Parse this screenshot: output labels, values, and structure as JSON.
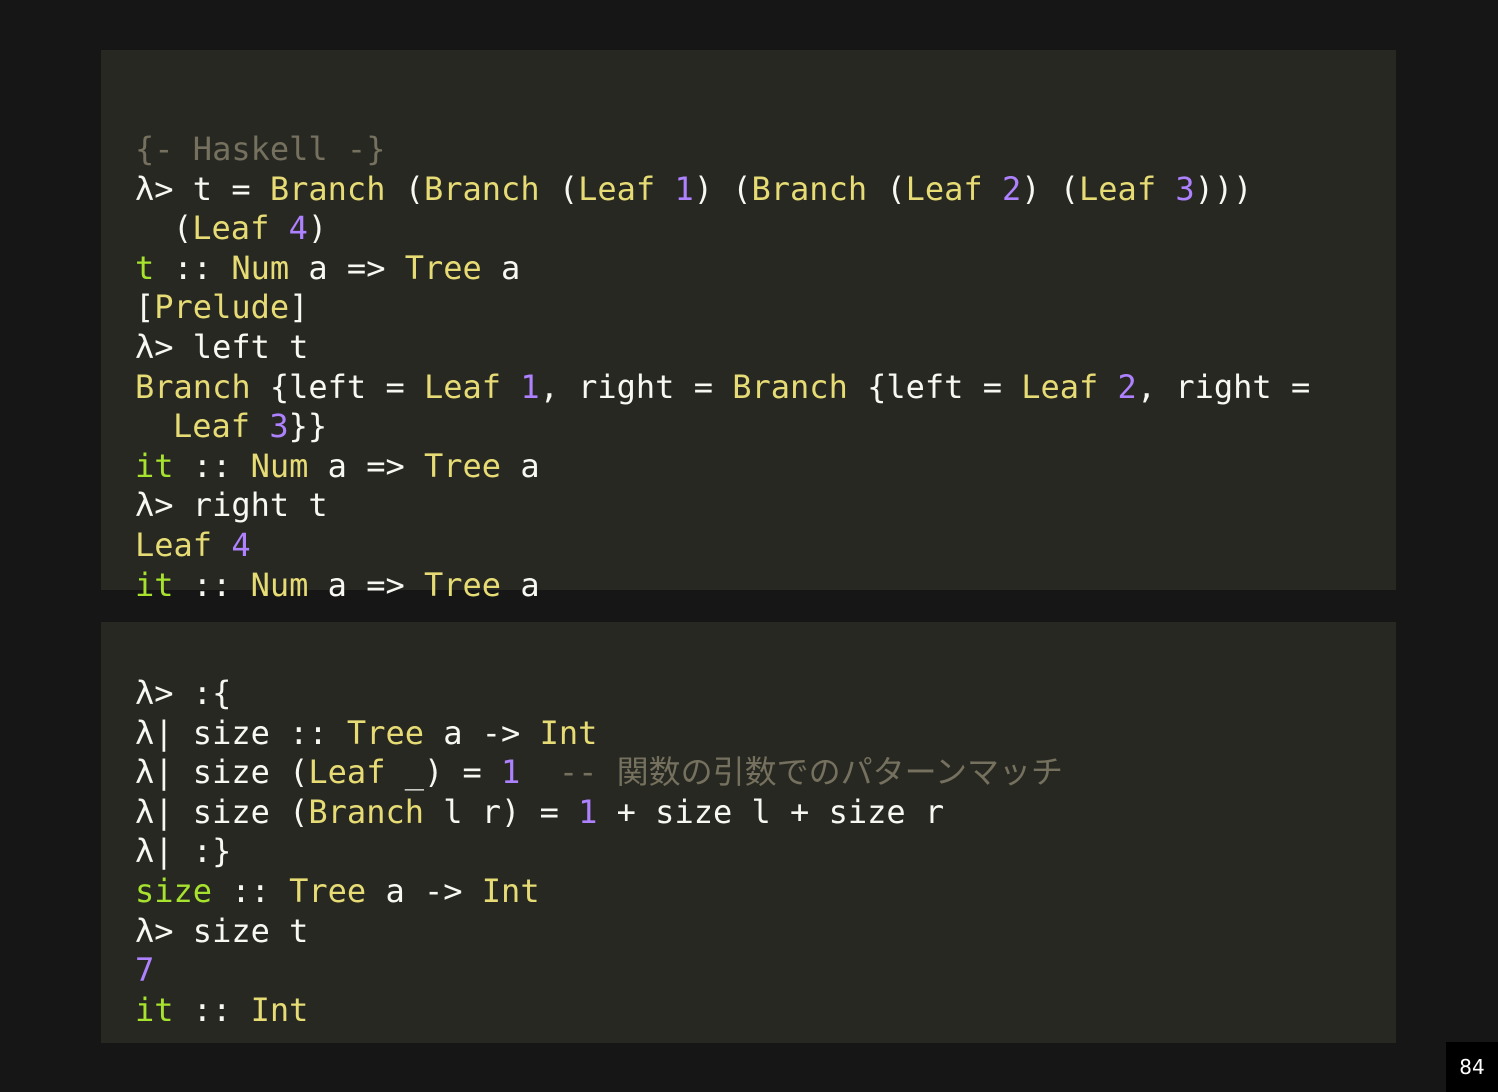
{
  "colors": {
    "background": "#161616",
    "panel": "#272822",
    "text": "#f8f8f2",
    "comment": "#75715e",
    "type": "#e6db74",
    "number": "#ae81ff",
    "name": "#a6e22e"
  },
  "panels": [
    {
      "lines": [
        {
          "tokens": [
            {
              "t": "{- Haskell -}",
              "c": "comment"
            }
          ]
        },
        {
          "tokens": [
            {
              "t": "λ> t = ",
              "c": "plain"
            },
            {
              "t": "Branch",
              "c": "type"
            },
            {
              "t": " (",
              "c": "plain"
            },
            {
              "t": "Branch",
              "c": "type"
            },
            {
              "t": " (",
              "c": "plain"
            },
            {
              "t": "Leaf",
              "c": "type"
            },
            {
              "t": " ",
              "c": "plain"
            },
            {
              "t": "1",
              "c": "num"
            },
            {
              "t": ") (",
              "c": "plain"
            },
            {
              "t": "Branch",
              "c": "type"
            },
            {
              "t": " (",
              "c": "plain"
            },
            {
              "t": "Leaf",
              "c": "type"
            },
            {
              "t": " ",
              "c": "plain"
            },
            {
              "t": "2",
              "c": "num"
            },
            {
              "t": ") (",
              "c": "plain"
            },
            {
              "t": "Leaf",
              "c": "type"
            },
            {
              "t": " ",
              "c": "plain"
            },
            {
              "t": "3",
              "c": "num"
            },
            {
              "t": ")))",
              "c": "plain"
            }
          ]
        },
        {
          "cont": true,
          "tokens": [
            {
              "t": "(",
              "c": "plain"
            },
            {
              "t": "Leaf",
              "c": "type"
            },
            {
              "t": " ",
              "c": "plain"
            },
            {
              "t": "4",
              "c": "num"
            },
            {
              "t": ")",
              "c": "plain"
            }
          ]
        },
        {
          "tokens": [
            {
              "t": "t",
              "c": "name"
            },
            {
              "t": " :: ",
              "c": "plain"
            },
            {
              "t": "Num",
              "c": "type"
            },
            {
              "t": " a => ",
              "c": "plain"
            },
            {
              "t": "Tree",
              "c": "type"
            },
            {
              "t": " a",
              "c": "plain"
            }
          ]
        },
        {
          "tokens": [
            {
              "t": "[",
              "c": "plain"
            },
            {
              "t": "Prelude",
              "c": "type"
            },
            {
              "t": "]",
              "c": "plain"
            }
          ]
        },
        {
          "tokens": [
            {
              "t": "λ> left t",
              "c": "plain"
            }
          ]
        },
        {
          "tokens": [
            {
              "t": "Branch",
              "c": "type"
            },
            {
              "t": " {left = ",
              "c": "plain"
            },
            {
              "t": "Leaf",
              "c": "type"
            },
            {
              "t": " ",
              "c": "plain"
            },
            {
              "t": "1",
              "c": "num"
            },
            {
              "t": ", right = ",
              "c": "plain"
            },
            {
              "t": "Branch",
              "c": "type"
            },
            {
              "t": " {left = ",
              "c": "plain"
            },
            {
              "t": "Leaf",
              "c": "type"
            },
            {
              "t": " ",
              "c": "plain"
            },
            {
              "t": "2",
              "c": "num"
            },
            {
              "t": ", right =",
              "c": "plain"
            }
          ]
        },
        {
          "cont": true,
          "tokens": [
            {
              "t": "Leaf",
              "c": "type"
            },
            {
              "t": " ",
              "c": "plain"
            },
            {
              "t": "3",
              "c": "num"
            },
            {
              "t": "}}",
              "c": "plain"
            }
          ]
        },
        {
          "tokens": [
            {
              "t": "it",
              "c": "name"
            },
            {
              "t": " :: ",
              "c": "plain"
            },
            {
              "t": "Num",
              "c": "type"
            },
            {
              "t": " a => ",
              "c": "plain"
            },
            {
              "t": "Tree",
              "c": "type"
            },
            {
              "t": " a",
              "c": "plain"
            }
          ]
        },
        {
          "tokens": [
            {
              "t": "λ> right t",
              "c": "plain"
            }
          ]
        },
        {
          "tokens": [
            {
              "t": "Leaf",
              "c": "type"
            },
            {
              "t": " ",
              "c": "plain"
            },
            {
              "t": "4",
              "c": "num"
            }
          ]
        },
        {
          "tokens": [
            {
              "t": "it",
              "c": "name"
            },
            {
              "t": " :: ",
              "c": "plain"
            },
            {
              "t": "Num",
              "c": "type"
            },
            {
              "t": " a => ",
              "c": "plain"
            },
            {
              "t": "Tree",
              "c": "type"
            },
            {
              "t": " a",
              "c": "plain"
            }
          ]
        }
      ]
    },
    {
      "lines": [
        {
          "tokens": [
            {
              "t": "λ> :{",
              "c": "plain"
            }
          ]
        },
        {
          "tokens": [
            {
              "t": "λ| size :: ",
              "c": "plain"
            },
            {
              "t": "Tree",
              "c": "type"
            },
            {
              "t": " a -> ",
              "c": "plain"
            },
            {
              "t": "Int",
              "c": "type"
            }
          ]
        },
        {
          "tokens": [
            {
              "t": "λ| size (",
              "c": "plain"
            },
            {
              "t": "Leaf",
              "c": "type"
            },
            {
              "t": " _) = ",
              "c": "plain"
            },
            {
              "t": "1",
              "c": "num"
            },
            {
              "t": "  ",
              "c": "plain"
            },
            {
              "t": "-- 関数の引数でのパターンマッチ",
              "c": "comment"
            }
          ]
        },
        {
          "tokens": [
            {
              "t": "λ| size (",
              "c": "plain"
            },
            {
              "t": "Branch",
              "c": "type"
            },
            {
              "t": " l r) = ",
              "c": "plain"
            },
            {
              "t": "1",
              "c": "num"
            },
            {
              "t": " + size l + size r",
              "c": "plain"
            }
          ]
        },
        {
          "tokens": [
            {
              "t": "λ| :}",
              "c": "plain"
            }
          ]
        },
        {
          "tokens": [
            {
              "t": "size",
              "c": "name"
            },
            {
              "t": " :: ",
              "c": "plain"
            },
            {
              "t": "Tree",
              "c": "type"
            },
            {
              "t": " a -> ",
              "c": "plain"
            },
            {
              "t": "Int",
              "c": "type"
            }
          ]
        },
        {
          "tokens": [
            {
              "t": "λ> size t",
              "c": "plain"
            }
          ]
        },
        {
          "tokens": [
            {
              "t": "7",
              "c": "num"
            }
          ]
        },
        {
          "tokens": [
            {
              "t": "it",
              "c": "name"
            },
            {
              "t": " :: ",
              "c": "plain"
            },
            {
              "t": "Int",
              "c": "type"
            }
          ]
        }
      ]
    }
  ],
  "page_number": "84"
}
